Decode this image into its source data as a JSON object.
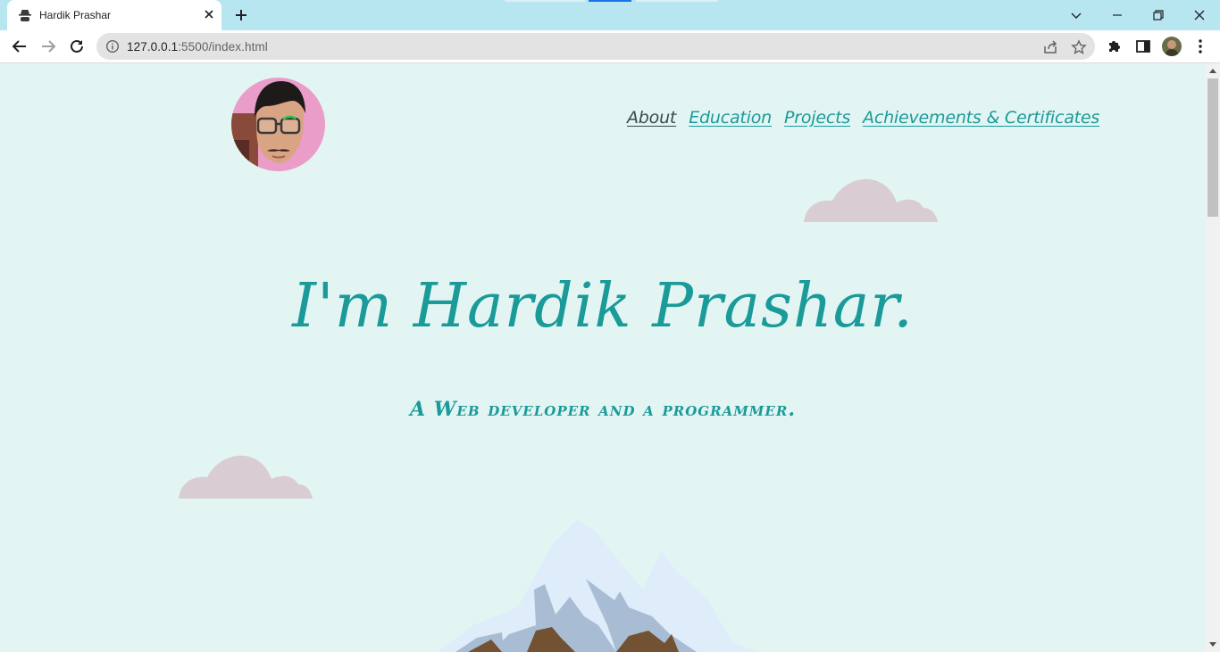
{
  "browser": {
    "tab_title": "Hardik Prashar",
    "url_host": "127.0.0.1",
    "url_rest": ":5500/index.html",
    "accent": "#1a73e8"
  },
  "page": {
    "nav": [
      {
        "label": "About",
        "active": true
      },
      {
        "label": "Education",
        "active": false
      },
      {
        "label": "Projects",
        "active": false
      },
      {
        "label": "Achievements & Certificates",
        "active": false
      }
    ],
    "hero_title": "I'm Hardik Prashar.",
    "hero_subtitle": "A Web developer and a programmer.",
    "colors": {
      "background": "#e2f5f3",
      "accent_teal": "#1a9a99",
      "active_link": "#3a4a48",
      "cloud": "#d9cdd3"
    }
  }
}
